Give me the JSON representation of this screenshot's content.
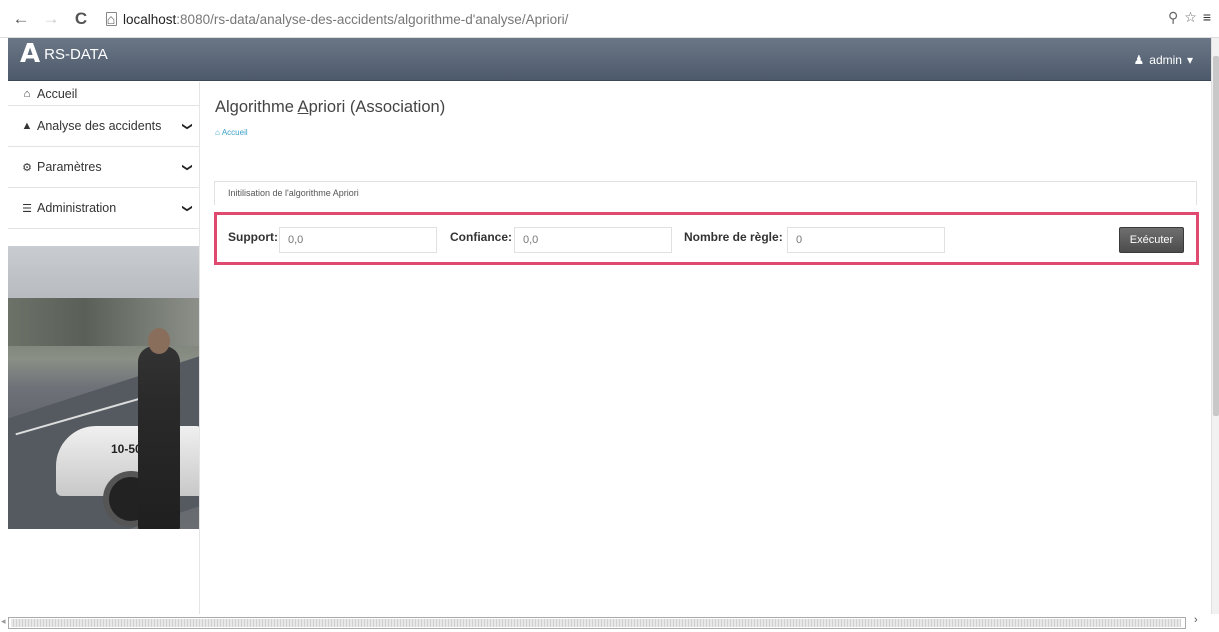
{
  "browser": {
    "back_glyph": "←",
    "forward_glyph": "→",
    "reload_glyph": "C",
    "home_glyph": "⌂",
    "url_host": "localhost",
    "url_rest": ":8080/rs-data/analyse-des-accidents/algorithme-d'analyse/Apriori/",
    "zoom_glyph": "⚲",
    "star_glyph": "☆",
    "menu_glyph": "≡"
  },
  "header": {
    "logo": "A",
    "brand": "RS-DATA",
    "user_icon": "♟",
    "user": "admin",
    "caret": "▾"
  },
  "sidebar": {
    "items": [
      {
        "icon": "⌂",
        "label": "Accueil"
      },
      {
        "icon": "▲",
        "label": "Analyse des accidents",
        "chevron": "❯"
      },
      {
        "icon": "⚙",
        "label": "Paramètres",
        "chevron": "❯"
      },
      {
        "icon": "☰",
        "label": "Administration",
        "chevron": "❯"
      }
    ]
  },
  "main": {
    "title_pre": "Algorithme ",
    "title_ul": "A",
    "title_post": "priori (Association)",
    "breadcrumb_icon": "⌂",
    "breadcrumb": "Accueil",
    "panel_heading": "Initilisation de l'algorithme Apriori",
    "form": {
      "support_label": "Support:",
      "support_value": "0,0",
      "confiance_label": "Confiance:",
      "confiance_value": "0,0",
      "nb_label": "Nombre de règle:",
      "nb_value": "0",
      "exec_label": "Exécuter"
    }
  },
  "photo": {
    "car_text": "10-50"
  },
  "colors": {
    "header": "#5b6777",
    "highlight": "#e04a70",
    "breadcrumb": "#3aa0c8",
    "button": "#5c5c5c"
  }
}
